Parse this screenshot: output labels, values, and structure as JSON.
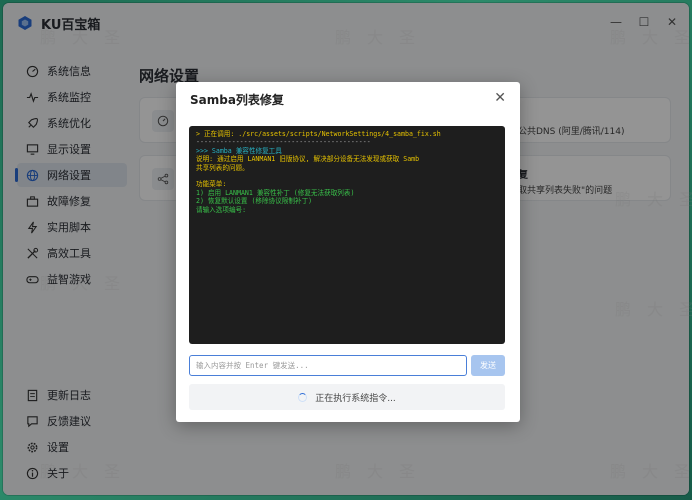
{
  "app": {
    "title": "KU百宝箱"
  },
  "window_controls": {
    "minimize": "—",
    "maximize": "☐",
    "close": "✕"
  },
  "sidebar": {
    "items": [
      {
        "label": "系统信息",
        "icon": "gauge-icon"
      },
      {
        "label": "系统监控",
        "icon": "pulse-icon"
      },
      {
        "label": "系统优化",
        "icon": "rocket-icon"
      },
      {
        "label": "显示设置",
        "icon": "monitor-icon"
      },
      {
        "label": "网络设置",
        "icon": "globe-icon",
        "active": true
      },
      {
        "label": "故障修复",
        "icon": "toolbox-icon"
      },
      {
        "label": "实用脚本",
        "icon": "bolt-icon"
      },
      {
        "label": "高效工具",
        "icon": "tools-icon"
      },
      {
        "label": "益智游戏",
        "icon": "gamepad-icon"
      }
    ],
    "bottom_items": [
      {
        "label": "更新日志",
        "icon": "log-icon"
      },
      {
        "label": "反馈建议",
        "icon": "chat-icon"
      },
      {
        "label": "设置",
        "icon": "gear-icon"
      },
      {
        "label": "关于",
        "icon": "info-icon"
      }
    ]
  },
  "main": {
    "page_title": "网络设置",
    "card1": {
      "side_text": "公共DNS (阿里/腾讯/114)"
    },
    "card2": {
      "side_title": "复",
      "side_text": "取共享列表失败\"的问题"
    }
  },
  "watermark": {
    "text": "鹏　大　圣"
  },
  "dialog": {
    "title": "Samba列表修复",
    "close_icon": "close-icon",
    "terminal_lines": [
      {
        "text": "> 正在调用: ./src/assets/scripts/NetworkSettings/4_samba_fix.sh",
        "color": "yellow"
      },
      {
        "text": "--------------------------------------------",
        "color": "gray"
      },
      {
        "text": ">>> Samba 兼容性修复工具",
        "color": "cyan"
      },
      {
        "text": "说明: 通过启用 LANMAN1 旧版协议, 解决部分设备无法发现或获取 Samb",
        "color": "yellow"
      },
      {
        "text": " 共享列表的问题。",
        "color": "yellow"
      },
      {
        "text": "",
        "color": "gray"
      },
      {
        "text": "功能菜单:",
        "color": "yellow"
      },
      {
        "text": "1) 启用 LANMAN1 兼容性补丁 (修复无法获取列表)",
        "color": "green"
      },
      {
        "text": "2) 恢复默认设置 (移除协议限制补丁)",
        "color": "green"
      },
      {
        "text": "请输入选项编号:",
        "color": "green"
      }
    ],
    "input": {
      "placeholder": "输入内容并按 Enter 键发送...",
      "value": ""
    },
    "send_label": "发送",
    "status_text": "正在执行系统指令...",
    "colors": {
      "yellow": "#e6c200",
      "green": "#39c24a",
      "cyan": "#28b3c4",
      "gray": "#aaaaaa"
    }
  }
}
